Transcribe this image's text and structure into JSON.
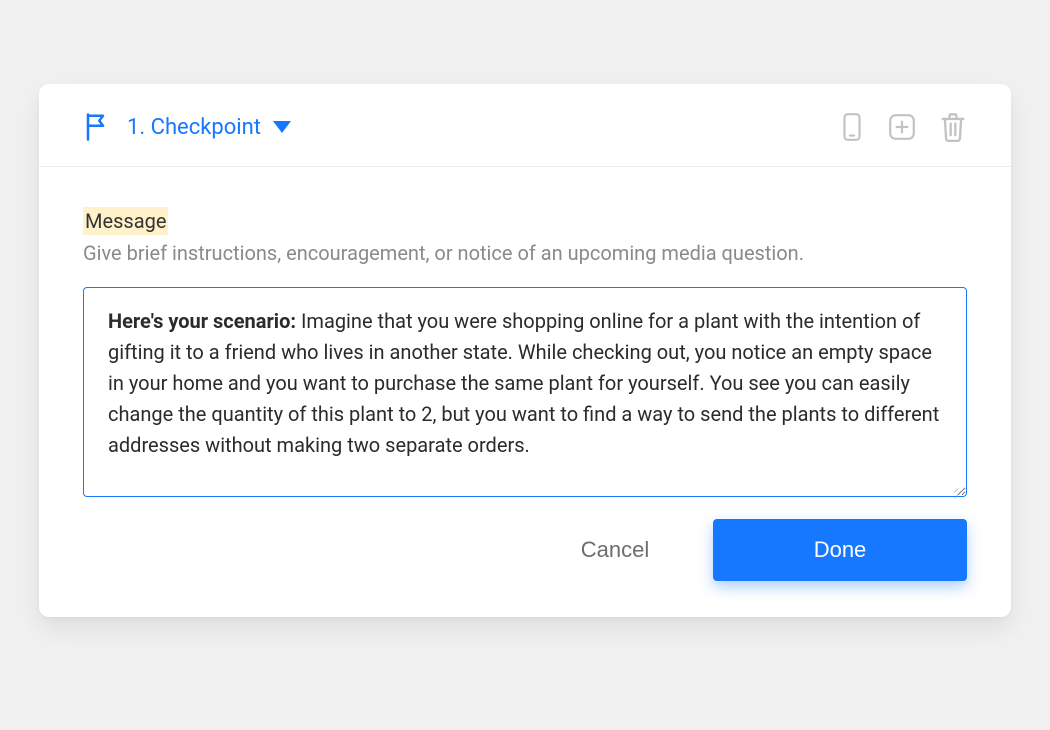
{
  "header": {
    "title": "1. Checkpoint",
    "icons": {
      "flag": "flag-icon",
      "caret": "chevron-down-icon",
      "mobile": "mobile-preview-icon",
      "duplicate": "add-card-icon",
      "trash": "trash-icon"
    }
  },
  "message": {
    "label": "Message",
    "helper": "Give brief instructions, encouragement, or notice of an upcoming media question.",
    "value_prefix_bold": "Here's your scenario:",
    "value_rest": " Imagine that you were shopping online for a plant with the intention of gifting it to a friend who lives in another state. While checking out, you notice an empty space in your home and you want to purchase the same plant for yourself. You see you can easily change the quantity of this plant to 2, but you want to find a way to send the plants to different addresses without making two separate orders."
  },
  "actions": {
    "cancel": "Cancel",
    "done": "Done"
  },
  "colors": {
    "accent": "#1677ff",
    "highlight": "#fff1c9",
    "muted": "#8a8a8a"
  }
}
